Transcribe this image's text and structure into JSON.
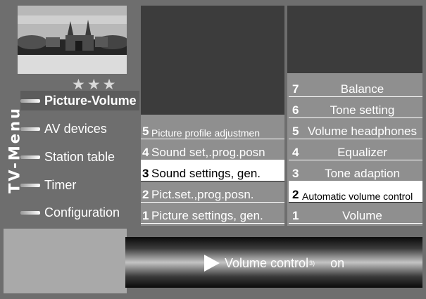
{
  "sidebar": {
    "title": "TV-Menu",
    "stars": "★★★",
    "items": [
      {
        "label": "Picture-Volume",
        "selected": true
      },
      {
        "label": "AV devices"
      },
      {
        "label": "Station table"
      },
      {
        "label": "Timer"
      },
      {
        "label": "Configuration"
      }
    ]
  },
  "submenu": {
    "items": [
      {
        "num": "5",
        "label": "Picture profile adjustmen"
      },
      {
        "num": "4",
        "label": "Sound set,.prog.posn"
      },
      {
        "num": "3",
        "label": "Sound settings, gen.",
        "selected": true
      },
      {
        "num": "2",
        "label": "Pict.set.,prog.posn."
      },
      {
        "num": "1",
        "label": "Picture settings, gen."
      }
    ]
  },
  "sound_menu": {
    "items": [
      {
        "num": "7",
        "label": "Balance"
      },
      {
        "num": "6",
        "label": "Tone setting"
      },
      {
        "num": "5",
        "label": "Volume headphones"
      },
      {
        "num": "4",
        "label": "Equalizer"
      },
      {
        "num": "3",
        "label": "Tone adaption"
      },
      {
        "num": "2",
        "label": "Automatic volume control",
        "selected": true
      },
      {
        "num": "1",
        "label": "Volume"
      }
    ]
  },
  "status_bar": {
    "icon": "play-icon",
    "label": "Volume control",
    "footnote": "3)",
    "value": "on"
  },
  "colors": {
    "background": "#6e6e6e",
    "dark_panel": "#3c3c3c",
    "selected": "#ffffff"
  }
}
